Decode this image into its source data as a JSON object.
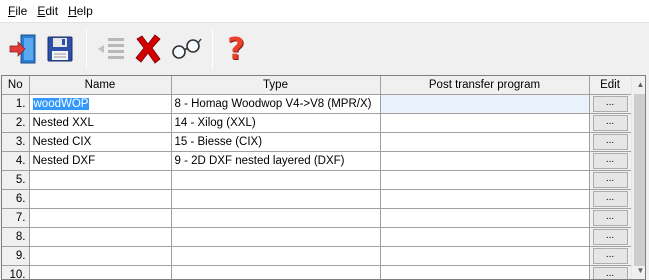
{
  "menu": [
    {
      "key": "F",
      "rest": "ile"
    },
    {
      "key": "E",
      "rest": "dit"
    },
    {
      "key": "H",
      "rest": "elp"
    }
  ],
  "toolbar": {
    "buttons": [
      "exit-icon",
      "save-icon",
      "list-icon",
      "delete-icon",
      "glasses-icon",
      "help-icon"
    ],
    "help_glyph": "?"
  },
  "grid": {
    "headers": {
      "no": "No",
      "name": "Name",
      "type": "Type",
      "post": "Post transfer program",
      "edit": "Edit"
    },
    "edit_button_label": "...",
    "rows": [
      {
        "no": "1.",
        "name": "woodWOP",
        "type": "8 - Homag Woodwop V4->V8 (MPR/X)",
        "post": "",
        "selected": true
      },
      {
        "no": "2.",
        "name": "Nested XXL",
        "type": "14 - Xilog (XXL)",
        "post": ""
      },
      {
        "no": "3.",
        "name": "Nested CIX",
        "type": "15 - Biesse (CIX)",
        "post": ""
      },
      {
        "no": "4.",
        "name": "Nested DXF",
        "type": "9 - 2D DXF nested layered (DXF)",
        "post": ""
      },
      {
        "no": "5.",
        "name": "",
        "type": "",
        "post": ""
      },
      {
        "no": "6.",
        "name": "",
        "type": "",
        "post": ""
      },
      {
        "no": "7.",
        "name": "",
        "type": "",
        "post": ""
      },
      {
        "no": "8.",
        "name": "",
        "type": "",
        "post": ""
      },
      {
        "no": "9.",
        "name": "",
        "type": "",
        "post": ""
      },
      {
        "no": "10.",
        "name": "",
        "type": "",
        "post": ""
      }
    ]
  },
  "scrollbar": {
    "up": "▲",
    "down": "▼"
  },
  "colors": {
    "selection": "#3399ff",
    "delete_red": "#d40000",
    "help_red": "#e8412b"
  }
}
